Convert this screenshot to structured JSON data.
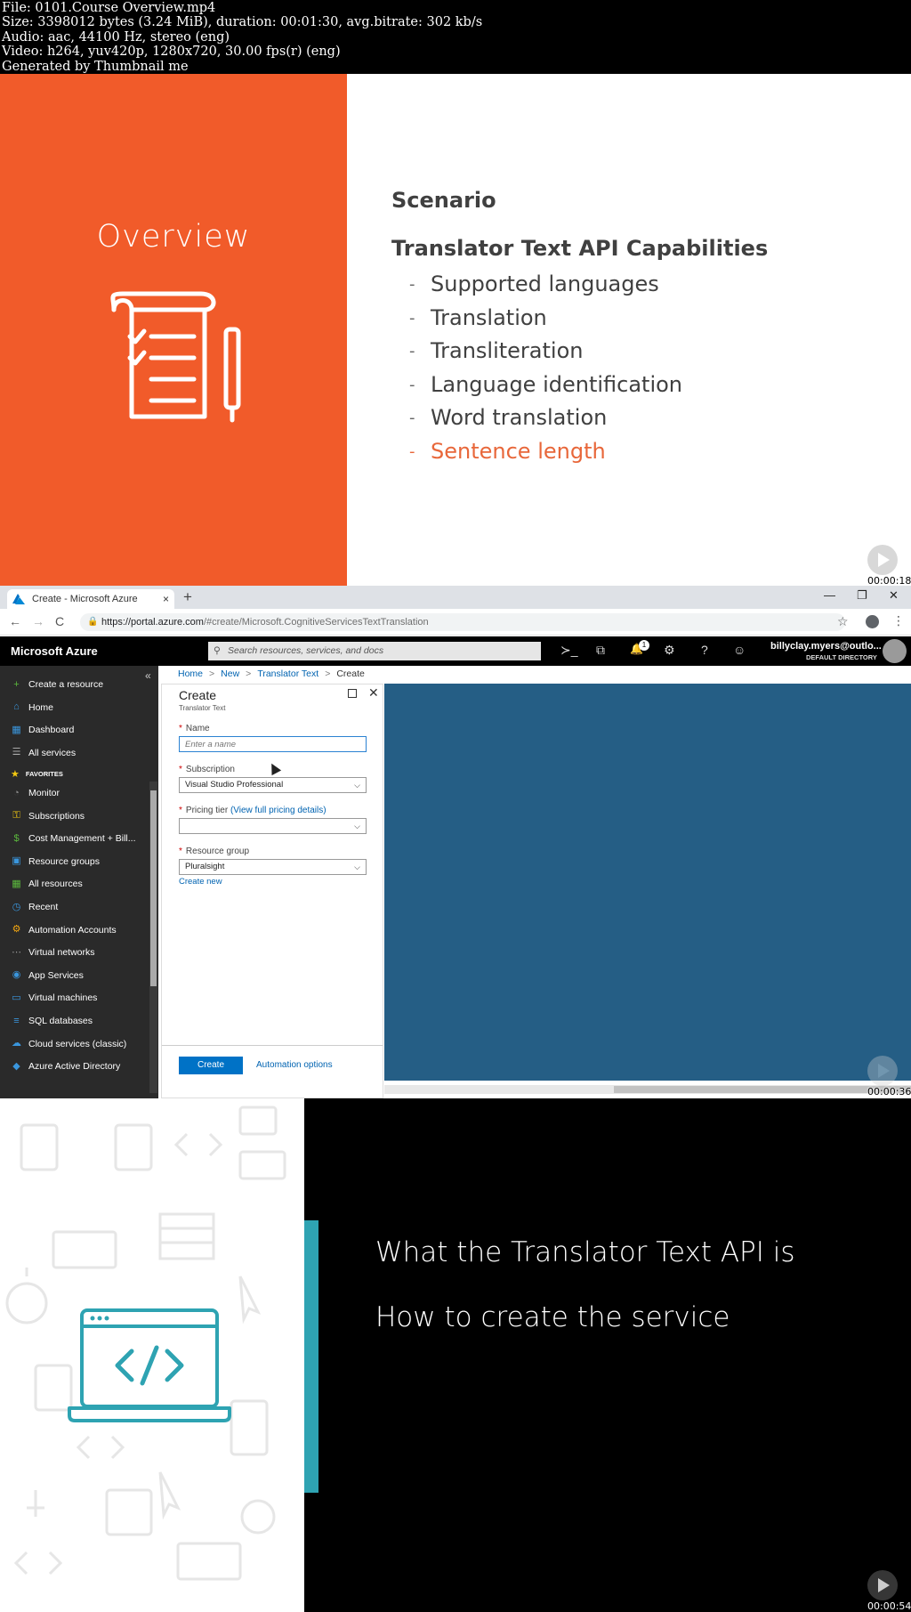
{
  "info": {
    "line1": "File: 0101.Course Overview.mp4",
    "line2": "Size: 3398012 bytes (3.24 MiB), duration: 00:01:30, avg.bitrate: 302 kb/s",
    "line3": "Audio: aac, 44100 Hz, stereo (eng)",
    "line4": "Video: h264, yuv420p, 1280x720, 30.00 fps(r) (eng)",
    "line5": "Generated by Thumbnail me"
  },
  "frame1": {
    "title": "Overview",
    "scenario": "Scenario",
    "heading": "Translator Text API Capabilities",
    "items": [
      {
        "label": "Supported languages",
        "dash": "-"
      },
      {
        "label": "Translation",
        "dash": "-"
      },
      {
        "label": "Transliteration",
        "dash": "-"
      },
      {
        "label": "Language identification",
        "dash": "-"
      },
      {
        "label": "Word translation",
        "dash": "-"
      },
      {
        "label": "Sentence length",
        "dash": "-"
      }
    ],
    "active_item_index": 5,
    "timestamp": "00:00:18",
    "accent_color": "#f15b2a"
  },
  "frame2": {
    "tab_title": "Create - Microsoft Azure",
    "tab_close": "×",
    "new_tab": "+",
    "win_min": "—",
    "win_restore": "❐",
    "win_close": "✕",
    "nav_back": "←",
    "nav_forward": "→",
    "nav_reload": "C",
    "url_host": "https://portal.azure.com",
    "url_rest": "/#create/Microsoft.CognitiveServicesTextTranslation",
    "lock": "🔒",
    "star": "☆",
    "kebab": "⋮",
    "brand": "Microsoft Azure",
    "search_placeholder": "Search resources, services, and docs",
    "search_icon": "⚲",
    "notif_count": "1",
    "icons": {
      "shell": "≻_",
      "filter": "⧉",
      "bell": "🔔",
      "gear": "⚙",
      "help": "?",
      "smiley": "☺"
    },
    "user_name": "billyclay.myers@outlo...",
    "user_dir": "DEFAULT DIRECTORY",
    "collapse": "«",
    "sidebar_top": [
      {
        "label": "Create a resource",
        "icon": "plus-icon",
        "color": "#5bb83d",
        "glyph": "+"
      },
      {
        "label": "Home",
        "icon": "home-icon",
        "color": "#3a96dd",
        "glyph": "⌂"
      },
      {
        "label": "Dashboard",
        "icon": "dashboard-icon",
        "color": "#3a96dd",
        "glyph": "▦"
      },
      {
        "label": "All services",
        "icon": "list-icon",
        "color": "#aaaaaa",
        "glyph": "☰"
      }
    ],
    "favorites_label": "FAVORITES",
    "sidebar_fav": [
      {
        "label": "Monitor",
        "icon": "monitor-icon",
        "color": "#8a8a8a",
        "glyph": "◔"
      },
      {
        "label": "Subscriptions",
        "icon": "key-icon",
        "color": "#f2c811",
        "glyph": "⚿"
      },
      {
        "label": "Cost Management + Bill...",
        "icon": "cost-icon",
        "color": "#5bb83d",
        "glyph": "$"
      },
      {
        "label": "Resource groups",
        "icon": "resource-groups-icon",
        "color": "#3a96dd",
        "glyph": "▣"
      },
      {
        "label": "All resources",
        "icon": "grid-icon",
        "color": "#5bb83d",
        "glyph": "▦"
      },
      {
        "label": "Recent",
        "icon": "clock-icon",
        "color": "#3a96dd",
        "glyph": "◷"
      },
      {
        "label": "Automation Accounts",
        "icon": "automation-icon",
        "color": "#f2a611",
        "glyph": "⚙"
      },
      {
        "label": "Virtual networks",
        "icon": "network-icon",
        "color": "#9a9a9a",
        "glyph": "⋯"
      },
      {
        "label": "App Services",
        "icon": "globe-icon",
        "color": "#3a96dd",
        "glyph": "◉"
      },
      {
        "label": "Virtual machines",
        "icon": "vm-icon",
        "color": "#3a96dd",
        "glyph": "▭"
      },
      {
        "label": "SQL databases",
        "icon": "sql-icon",
        "color": "#3a96dd",
        "glyph": "≡"
      },
      {
        "label": "Cloud services (classic)",
        "icon": "cloud-icon",
        "color": "#3a96dd",
        "glyph": "☁"
      },
      {
        "label": "Azure Active Directory",
        "icon": "aad-icon",
        "color": "#3a96dd",
        "glyph": "◆"
      }
    ],
    "breadcrumb": [
      "Home",
      "New",
      "Translator Text",
      "Create"
    ],
    "crumb_sep": ">",
    "blade_title": "Create",
    "blade_subtitle": "Translator Text",
    "blade_close": "✕",
    "required_mark": "*",
    "name_label": "Name",
    "name_placeholder": "Enter a name",
    "subscription_label": "Subscription",
    "subscription_value": "Visual Studio Professional",
    "pricing_label": "Pricing tier",
    "pricing_link": "(View full pricing details)",
    "pricing_value": "",
    "rg_label": "Resource group",
    "rg_value": "Pluralsight",
    "create_new": "Create new",
    "chevron": "⌵",
    "create_button": "Create",
    "automation_link": "Automation options",
    "timestamp": "00:00:36"
  },
  "frame3": {
    "line1": "What the Translator Text API is",
    "line2": "How to create the service",
    "timestamp": "00:00:54",
    "accent_color": "#2ea3b2"
  }
}
